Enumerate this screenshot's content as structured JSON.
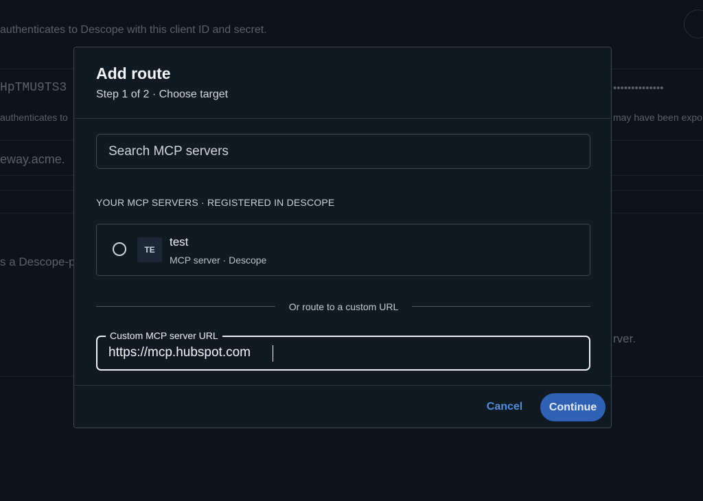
{
  "background": {
    "line1": "authenticates to Descope with this client ID and secret.",
    "client_id": "HpTMU9TS3",
    "line2_left": "authenticates to",
    "masked_secret": "••••••••••••••",
    "line2_right": "may have been expo",
    "gateway": "eway.acme.",
    "descope_text": "s a Descope-p",
    "rver_text": "rver."
  },
  "dialog": {
    "title": "Add route",
    "subtitle": "Step 1 of 2 · Choose target",
    "search": {
      "placeholder": "Search MCP servers",
      "value": ""
    },
    "section_label": "YOUR MCP SERVERS · REGISTERED IN DESCOPE",
    "servers": [
      {
        "badge": "TE",
        "name": "test",
        "meta": "MCP server · Descope",
        "selected": false
      }
    ],
    "divider_text": "Or route to a custom URL",
    "custom_url": {
      "label": "Custom MCP server URL",
      "value": "https://mcp.hubspot.com"
    },
    "cancel_label": "Cancel",
    "continue_label": "Continue"
  },
  "colors": {
    "accent": "#2f62b5",
    "link": "#4f8fe0",
    "background": "#0f1620",
    "dialog": "#111922"
  }
}
